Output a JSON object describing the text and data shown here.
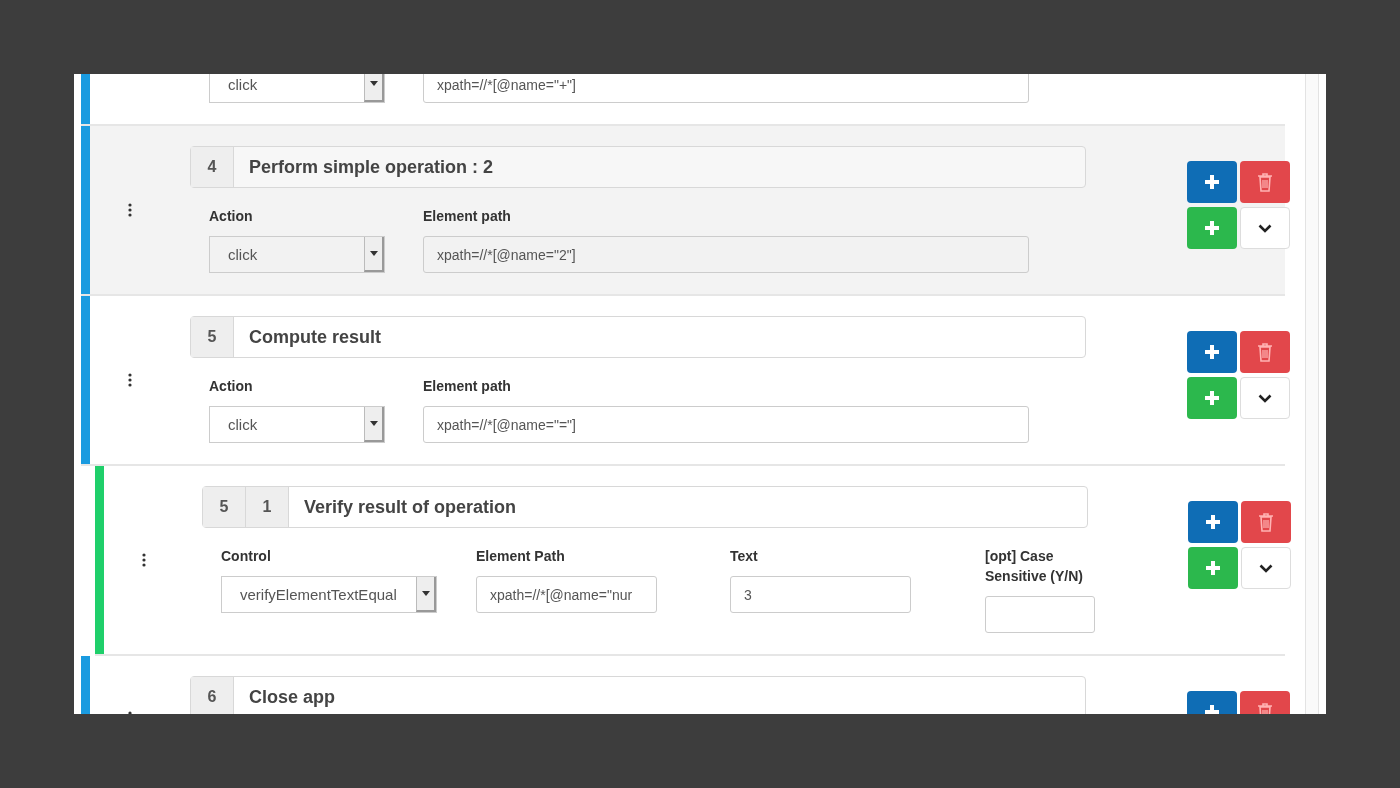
{
  "steps": [
    {
      "kind": "step",
      "highlighted": false,
      "fields": [
        {
          "kind": "select",
          "value": "click"
        },
        {
          "kind": "text",
          "value": "xpath=//*[@name=\"+\"]"
        }
      ]
    },
    {
      "kind": "step",
      "highlighted": true,
      "numbers": [
        "4"
      ],
      "title": "Perform simple operation : 2",
      "fields": [
        {
          "kind": "select",
          "label": "Action",
          "value": "click"
        },
        {
          "kind": "text",
          "label": "Element path",
          "value": "xpath=//*[@name=\"2\"]"
        }
      ]
    },
    {
      "kind": "step",
      "highlighted": false,
      "numbers": [
        "5"
      ],
      "title": "Compute result",
      "fields": [
        {
          "kind": "select",
          "label": "Action",
          "value": "click"
        },
        {
          "kind": "text",
          "label": "Element path",
          "value": "xpath=//*[@name=\"=\"]"
        }
      ]
    },
    {
      "kind": "substep",
      "highlighted": false,
      "numbers": [
        "5",
        "1"
      ],
      "title": "Verify result of operation",
      "fields": [
        {
          "kind": "select",
          "label": "Control",
          "value": "verifyElementTextEqual"
        },
        {
          "kind": "text",
          "label": "Element Path",
          "value": "xpath=//*[@name=\"nur"
        },
        {
          "kind": "text",
          "label": "Text",
          "value": "3"
        },
        {
          "kind": "text",
          "label": "[opt] Case Sensitive (Y/N)"
        }
      ]
    },
    {
      "kind": "step",
      "highlighted": false,
      "numbers": [
        "6"
      ],
      "title": "Close app"
    }
  ]
}
